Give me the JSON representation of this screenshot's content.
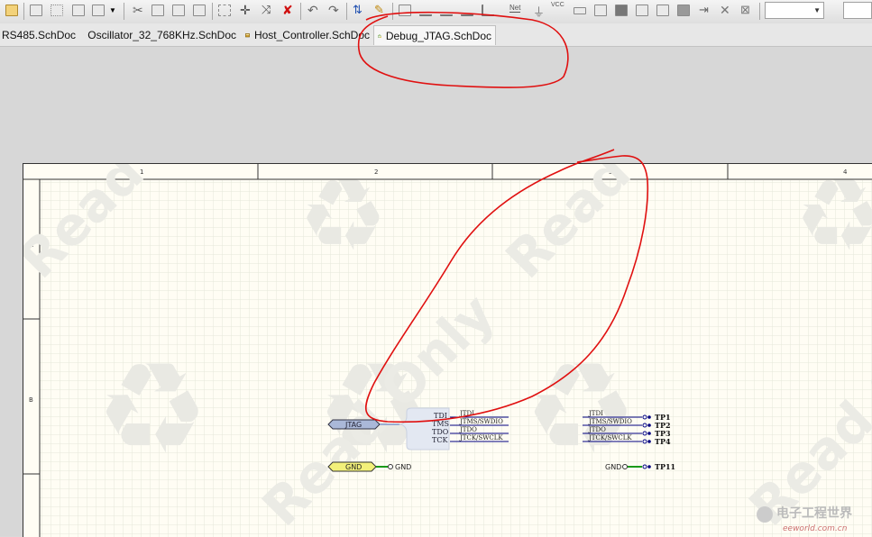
{
  "tabs": [
    {
      "label": "RS485.SchDoc",
      "active": false,
      "icon": "schematic-doc-icon"
    },
    {
      "label": "Oscillator_32_768KHz.SchDoc",
      "active": false,
      "icon": "schematic-doc-icon"
    },
    {
      "label": "Host_Controller.SchDoc",
      "active": false,
      "icon": "schematic-doc-icon"
    },
    {
      "label": "Debug_JTAG.SchDoc",
      "active": true,
      "icon": "schematic-doc-icon"
    }
  ],
  "toolbar": {
    "net_label": "Net",
    "vcc_label": "VCC",
    "zoom_value": ""
  },
  "sheet": {
    "columns": [
      "1",
      "2",
      "3",
      "4"
    ],
    "rows": [
      "A",
      "B"
    ],
    "watermark": "Read Only"
  },
  "schematic": {
    "port_jtag": "JTAG",
    "port_gnd": "GND",
    "gnd_symbol_label": "GND",
    "harness_pins": [
      "TDI",
      "TMS",
      "TDO",
      "TCK"
    ],
    "net_labels_left": [
      "JTDI",
      "JTMS/SWDIO",
      "JTDO",
      "JTCK/SWCLK"
    ],
    "net_labels_right": [
      "JTDI",
      "JTMS/SWDIO",
      "JTDO",
      "JTCK/SWCLK"
    ],
    "testpoints": [
      "TP1",
      "TP2",
      "TP3",
      "TP4"
    ],
    "gnd_right_label": "GND",
    "tp11": "TP11"
  },
  "logo": {
    "text": "电子工程世界",
    "subtext": "eeworld.com.cn"
  },
  "colors": {
    "annotation": "#e01010",
    "port_fill": "#aab8d8",
    "gnd_port_fill": "#f2f07a",
    "wire": "#000080",
    "wire_green": "#1a9a1a",
    "sheet_bg": "#fffdf4",
    "grid": "#e9ece0"
  }
}
